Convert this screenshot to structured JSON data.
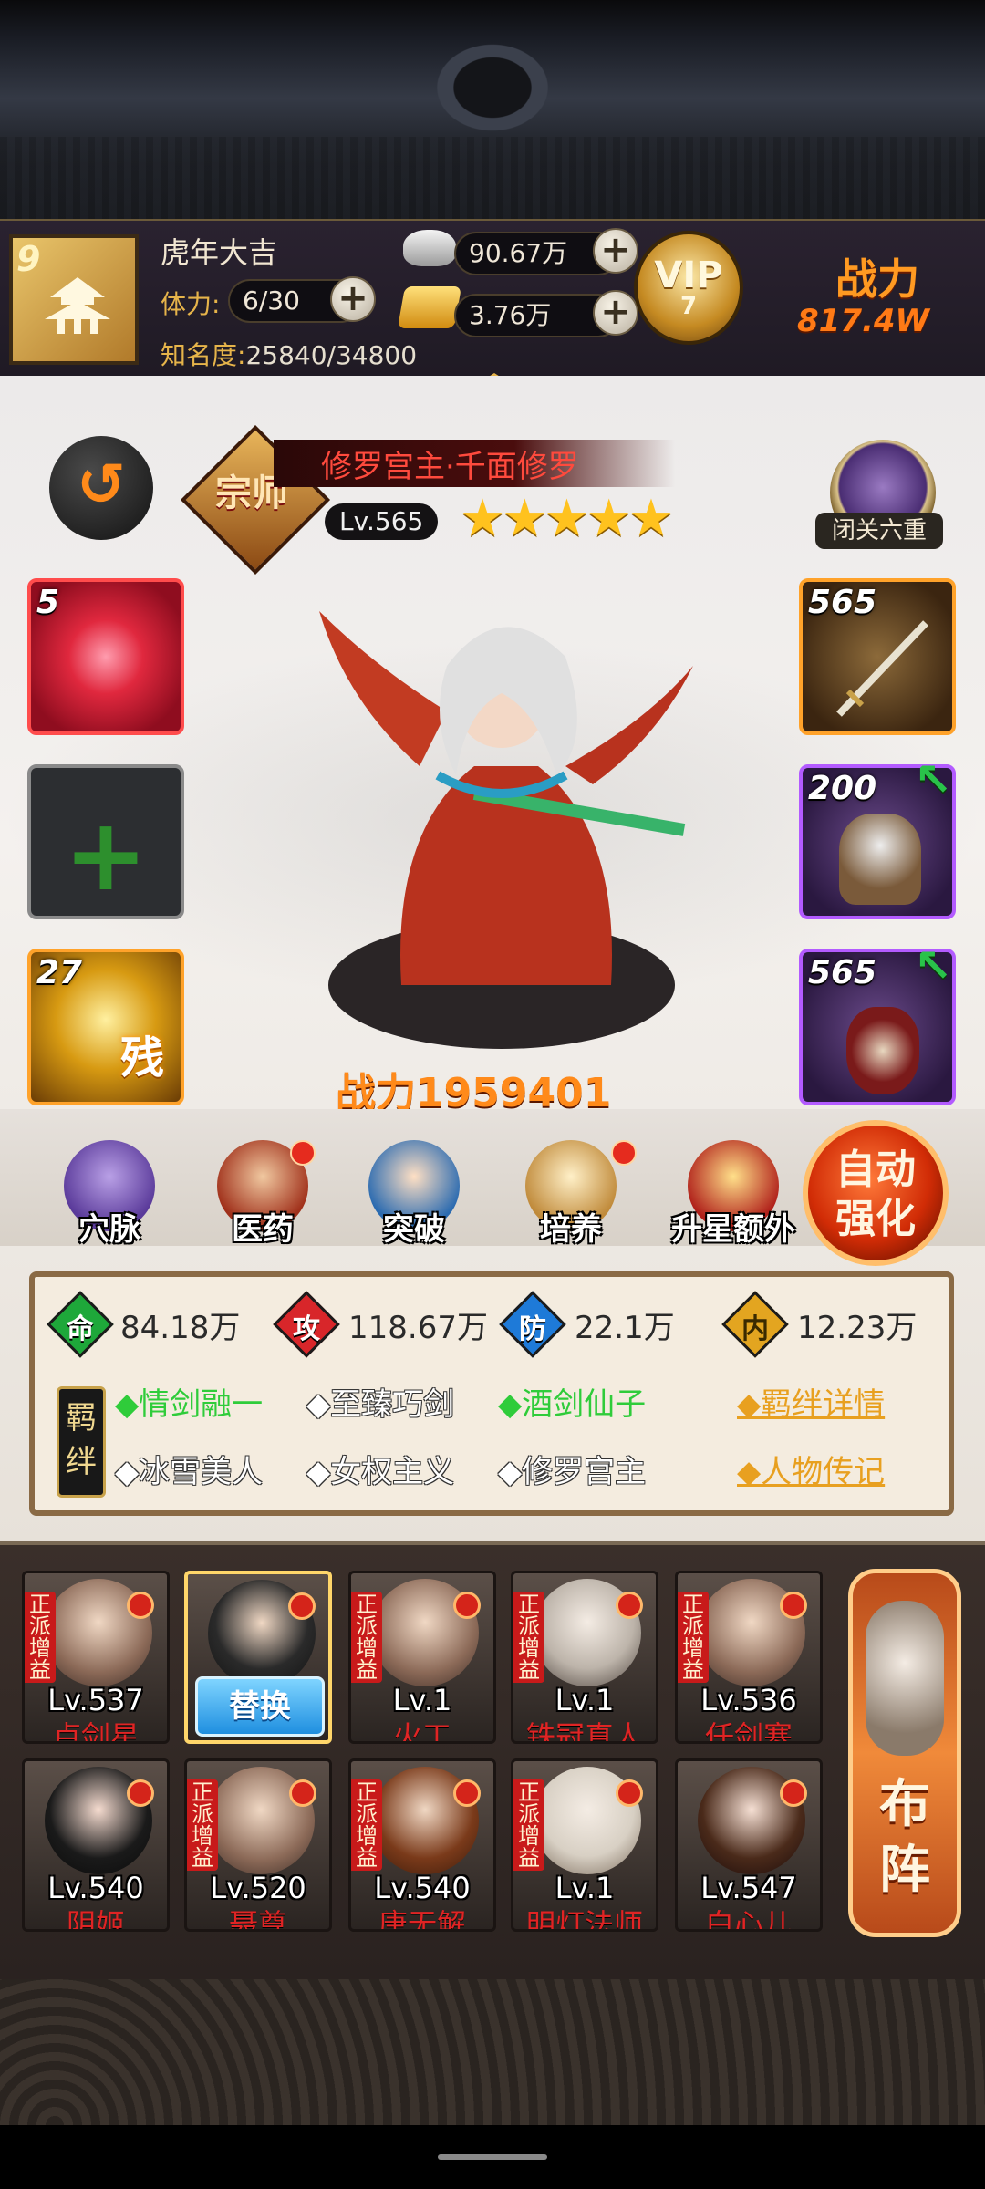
{
  "player": {
    "level": "9",
    "name": "虎年大吉",
    "stamina_label": "体力:",
    "stamina_value": "6/30",
    "fame_label": "知名度:",
    "fame_value": "25840/34800",
    "silver": "90.67万",
    "gold": "3.76万",
    "vip_text": "VIP",
    "vip_level": "7",
    "power_label": "战力",
    "power_value": "817.4W"
  },
  "hero": {
    "crest": "宗师",
    "name": "修罗宫主·千面修罗",
    "level": "Lv.565",
    "stars": "★★★★★",
    "power": "战力1959401",
    "seclusion": "闭关六重"
  },
  "left_slots": [
    {
      "num": "5",
      "type": "martial-art"
    },
    {
      "num": "",
      "type": "empty"
    },
    {
      "num": "27",
      "type": "residual",
      "badge": "残"
    }
  ],
  "right_slots": [
    {
      "num": "565",
      "type": "weapon"
    },
    {
      "num": "200",
      "type": "armor"
    },
    {
      "num": "565",
      "type": "accessory"
    }
  ],
  "actions": [
    {
      "label": "穴脉",
      "dot": false
    },
    {
      "label": "医药",
      "dot": true
    },
    {
      "label": "突破",
      "dot": false
    },
    {
      "label": "培养",
      "dot": true
    },
    {
      "label": "升星额外",
      "dot": false
    }
  ],
  "auto_button": "自动强化",
  "stats": [
    {
      "char": "命",
      "value": "84.18万",
      "color": "#1ea83a"
    },
    {
      "char": "攻",
      "value": "118.67万",
      "color": "#d8262a"
    },
    {
      "char": "防",
      "value": "22.1万",
      "color": "#1e7ad8"
    },
    {
      "char": "内",
      "value": "12.23万",
      "color": "#e3a520"
    }
  ],
  "bond_tag": "羁绊",
  "bonds_row1": [
    {
      "text": "◆情剑融一",
      "active": true
    },
    {
      "text": "◆至臻巧剑",
      "active": false
    },
    {
      "text": "◆酒剑仙子",
      "active": true
    }
  ],
  "bonds_row2": [
    {
      "text": "◆冰雪美人",
      "active": false
    },
    {
      "text": "◆女权主义",
      "active": false
    },
    {
      "text": "◆修罗宫主",
      "active": false
    }
  ],
  "bond_details": "◆羁绊详情",
  "biography": "◆人物传记",
  "boost_label": "正派增益",
  "swap_label": "替换",
  "roster_row1": [
    {
      "level": "Lv.537",
      "name": "卢剑星",
      "boost": true,
      "dot": true
    },
    {
      "level": "",
      "name": "",
      "boost": false,
      "dot": true,
      "selected": true
    },
    {
      "level": "Lv.1",
      "name": "火工",
      "boost": true,
      "dot": true
    },
    {
      "level": "Lv.1",
      "name": "铁冠真人",
      "boost": true,
      "dot": true
    },
    {
      "level": "Lv.536",
      "name": "任剑寒",
      "boost": true,
      "dot": true
    }
  ],
  "roster_row2": [
    {
      "level": "Lv.540",
      "name": "阴姬",
      "boost": false,
      "dot": true
    },
    {
      "level": "Lv.520",
      "name": "聂尊",
      "boost": true,
      "dot": true
    },
    {
      "level": "Lv.540",
      "name": "唐无解",
      "boost": true,
      "dot": true
    },
    {
      "level": "Lv.1",
      "name": "明灯法师",
      "boost": true,
      "dot": true
    },
    {
      "level": "Lv.547",
      "name": "白心儿",
      "boost": false,
      "dot": true
    }
  ],
  "formation_label": "布阵"
}
